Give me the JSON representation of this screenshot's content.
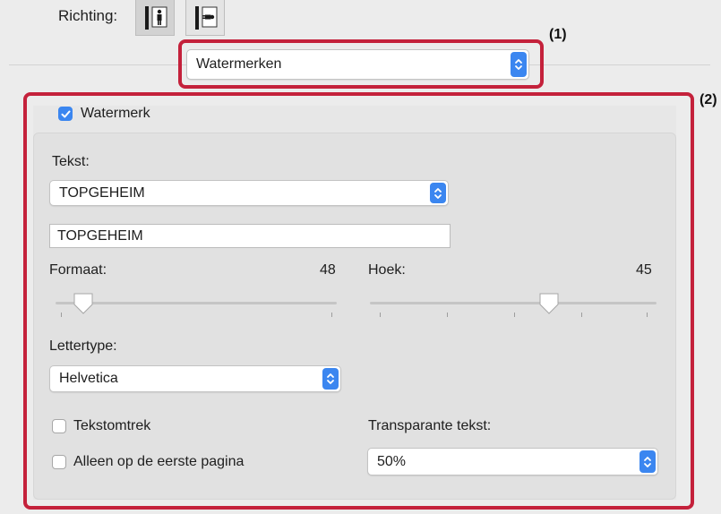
{
  "orientation": {
    "label": "Richting:",
    "options": [
      "portrait",
      "landscape"
    ],
    "selected": "portrait"
  },
  "callouts": [
    "(1)",
    "(2)"
  ],
  "section_select": {
    "value": "Watermerken"
  },
  "watermark": {
    "enabled_label": "Watermerk",
    "enabled": true,
    "text_label": "Tekst:",
    "text_select_value": "TOPGEHEIM",
    "text_field_value": "TOPGEHEIM",
    "size": {
      "label": "Formaat:",
      "value": "48",
      "fraction": 0.1
    },
    "angle": {
      "label": "Hoek:",
      "value": "45",
      "fraction": 0.625
    },
    "font_label": "Lettertype:",
    "font_value": "Helvetica",
    "outline": {
      "label": "Tekstomtrek",
      "checked": false
    },
    "first_page_only": {
      "label": "Alleen op de eerste pagina",
      "checked": false
    },
    "transparency": {
      "label": "Transparante tekst:",
      "value": "50%"
    }
  },
  "colors": {
    "accent": "#3b86f0",
    "callout_frame": "#c4213b"
  }
}
